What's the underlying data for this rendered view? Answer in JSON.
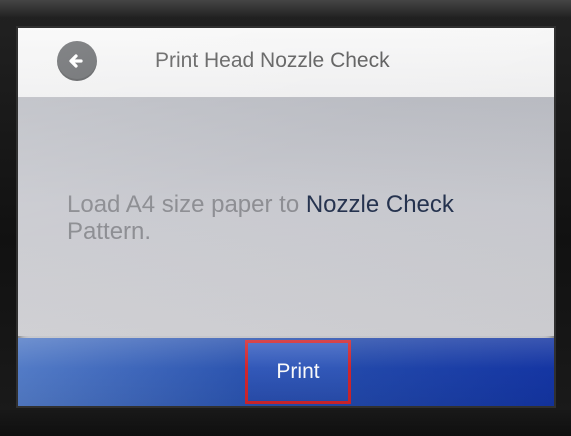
{
  "header": {
    "title": "Print Head Nozzle Check",
    "back_icon": "arrow-left-icon"
  },
  "main": {
    "message_lead": "Load A4 size paper to ",
    "message_highlight": "Nozzle Check",
    "message_tail": "Pattern."
  },
  "footer": {
    "print_label": "Print"
  },
  "colors": {
    "title_text": "#555555",
    "message_text": "#8a8b90",
    "highlight_text": "#1f2d4a",
    "bottom_bar": "#1436a7",
    "button_highlight_border": "#d4232a",
    "back_button": "#5f6164"
  }
}
